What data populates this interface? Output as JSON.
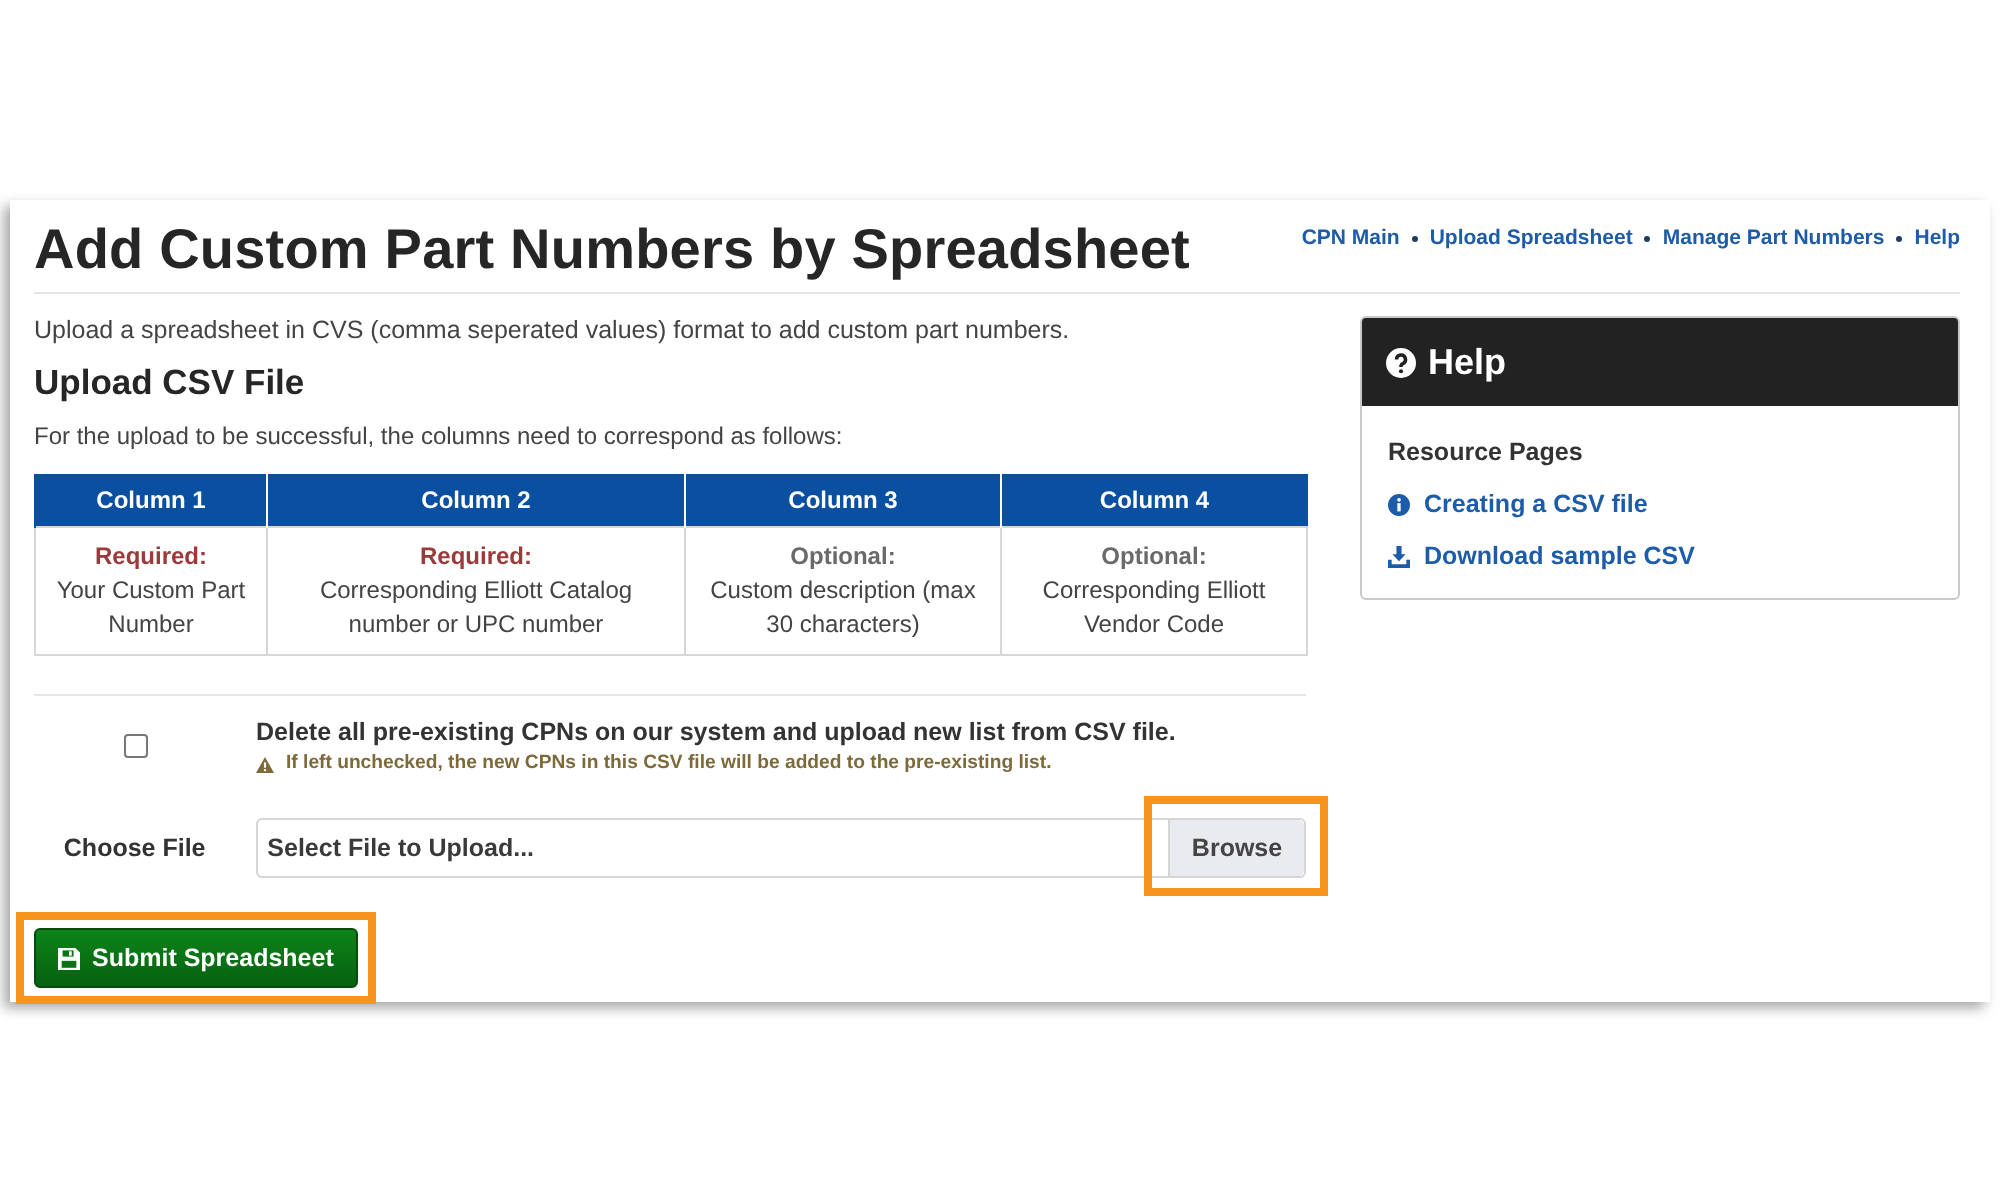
{
  "page_title": "Add Custom Part Numbers by Spreadsheet",
  "nav_links": [
    "CPN Main",
    "Upload Spreadsheet",
    "Manage Part Numbers",
    "Help"
  ],
  "intro": "Upload a spreadsheet in CVS (comma seperated values) format to add custom part numbers.",
  "section_title": "Upload CSV File",
  "instructions": "For the upload to be successful, the columns need to correspond as follows:",
  "table": {
    "columns": [
      "Column 1",
      "Column 2",
      "Column 3",
      "Column 4"
    ],
    "cells": [
      {
        "kind": "required",
        "label": "Required:",
        "text": "Your Custom Part Number"
      },
      {
        "kind": "required",
        "label": "Required:",
        "text": "Corresponding Elliott Catalog number or UPC number"
      },
      {
        "kind": "optional",
        "label": "Optional:",
        "text": "Custom description (max 30 characters)"
      },
      {
        "kind": "optional",
        "label": "Optional:",
        "text": "Corresponding Elliott Vendor Code"
      }
    ]
  },
  "delete_option": {
    "label": "Delete all pre-existing CPNs on our system and upload new list from CSV file.",
    "checked": false,
    "warning": "If left unchecked, the new CPNs in this CSV file will be added to the pre-existing list."
  },
  "file_field": {
    "label": "Choose File",
    "placeholder": "Select File to Upload...",
    "button": {
      "label": "Browse",
      "highlighted": true
    }
  },
  "submit_button": {
    "label": "Submit Spreadsheet",
    "highlighted": true
  },
  "help_panel": {
    "title": "Help",
    "section_title": "Resource Pages",
    "links": [
      {
        "kind": "info",
        "label": "Creating a CSV file"
      },
      {
        "kind": "download",
        "label": "Download sample CSV"
      }
    ]
  }
}
